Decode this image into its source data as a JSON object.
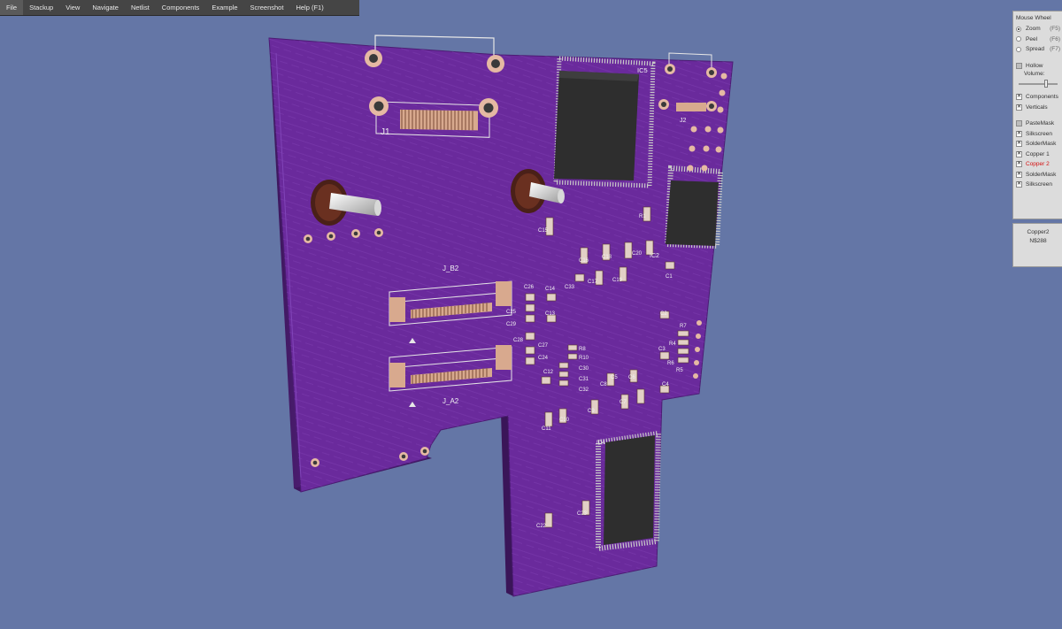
{
  "menu": [
    "File",
    "Stackup",
    "View",
    "Navigate",
    "Netlist",
    "Components",
    "Example",
    "Screenshot",
    "Help (F1)"
  ],
  "panel": {
    "mouse_wheel_label": "Mouse Wheel",
    "wheel_modes": [
      {
        "label": "Zoom",
        "key": "(F5)",
        "selected": true
      },
      {
        "label": "Peel",
        "key": "(F6)",
        "selected": false
      },
      {
        "label": "Spread",
        "key": "(F7)",
        "selected": false
      }
    ],
    "hollow_label": "Hollow",
    "hollow_checked": false,
    "volume_label": "Volume:",
    "volume_value": 0.72,
    "view_toggles": [
      {
        "label": "Components",
        "checked": true
      },
      {
        "label": "Verticals",
        "checked": true
      }
    ],
    "layers": [
      {
        "label": "PasteMask",
        "checked": false
      },
      {
        "label": "Silkscreen",
        "checked": true
      },
      {
        "label": "SolderMask",
        "checked": true
      },
      {
        "label": "Copper 1",
        "checked": true
      },
      {
        "label": "Copper 2",
        "checked": true,
        "active": true
      },
      {
        "label": "SolderMask",
        "checked": true
      },
      {
        "label": "Silkscreen",
        "checked": true
      }
    ]
  },
  "info": {
    "layer": "Copper2",
    "net": "N$288"
  },
  "board": {
    "color": "#6a2a9c",
    "refs": [
      "J1",
      "J2",
      "IC5",
      "IC2",
      "IC4",
      "J_B2",
      "J_A2",
      "R1",
      "R8",
      "R10",
      "R7",
      "R4",
      "R6",
      "R5",
      "C1",
      "C2",
      "C3",
      "C4",
      "C5",
      "C6",
      "C7",
      "C8",
      "C9",
      "C10",
      "C11",
      "C12",
      "C13",
      "C14",
      "C15",
      "C16",
      "C17",
      "C18",
      "C19",
      "C20",
      "C22",
      "C23",
      "C24",
      "C25",
      "C26",
      "C27",
      "C28",
      "C29",
      "C30",
      "C31",
      "C32",
      "C33"
    ]
  }
}
